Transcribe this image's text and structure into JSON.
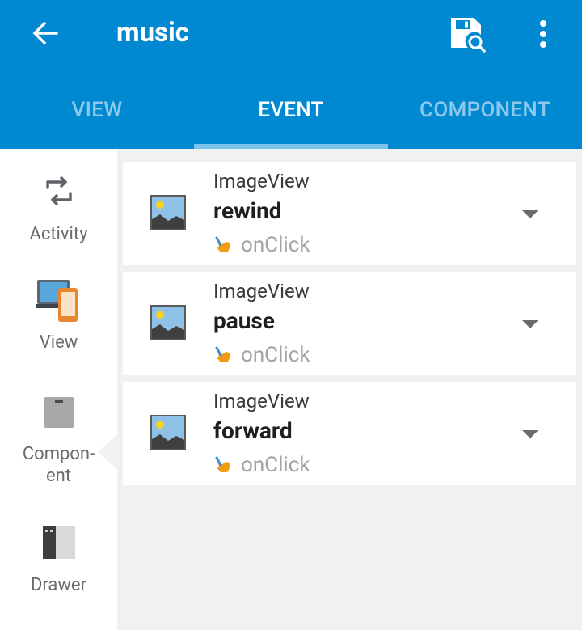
{
  "appbar": {
    "title": "music",
    "back_icon": "arrow-left-icon",
    "save_icon": "save-search-icon",
    "more_icon": "more-vertical-icon",
    "background": "#0089d1"
  },
  "tabs": [
    {
      "label": "VIEW",
      "active": false
    },
    {
      "label": "EVENT",
      "active": true
    },
    {
      "label": "COMPONENT",
      "active": false
    }
  ],
  "sidebar": {
    "items": [
      {
        "label": "Activity",
        "icon": "refresh-cycle-icon",
        "active": false
      },
      {
        "label": "View",
        "icon": "devices-icon",
        "active": true
      },
      {
        "label": "Compon-\nent",
        "icon": "box-icon",
        "active": false
      },
      {
        "label": "Drawer",
        "icon": "drawer-panel-icon",
        "active": false
      }
    ]
  },
  "events": [
    {
      "type": "ImageView",
      "name": "rewind",
      "event": "onClick",
      "icon": "image-thumbnail-icon"
    },
    {
      "type": "ImageView",
      "name": "pause",
      "event": "onClick",
      "icon": "image-thumbnail-icon"
    },
    {
      "type": "ImageView",
      "name": "forward",
      "event": "onClick",
      "icon": "image-thumbnail-icon"
    }
  ],
  "colors": {
    "accent": "#0089d1",
    "tab_indicator": "#7ec3ea",
    "inactive_tab": "#8cc8ec",
    "event_icon": "#f39c12"
  }
}
